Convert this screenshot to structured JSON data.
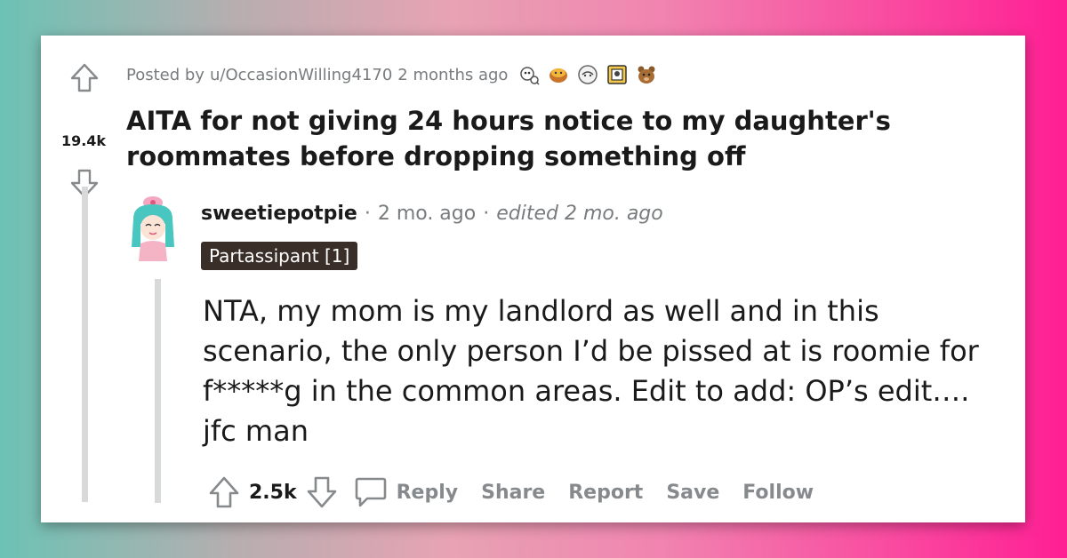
{
  "post": {
    "posted_by_prefix": "Posted by",
    "author": "u/OccasionWilling4170",
    "age": "2 months ago",
    "score": "19.4k",
    "title": "AITA for not giving 24 hours notice to my daughter's roommates before dropping something off"
  },
  "comment": {
    "author": "sweetiepotpie",
    "separator": "·",
    "age": "2 mo. ago",
    "edited": "edited 2 mo. ago",
    "flair": "Partassipant [1]",
    "body": "NTA, my mom is my landlord as well and in this scenario, the only person I’d be pissed at is roomie for f*****g in the common areas. Edit to add: OP’s edit…. jfc man",
    "score": "2.5k",
    "actions": {
      "reply": "Reply",
      "share": "Share",
      "report": "Report",
      "save": "Save",
      "follow": "Follow"
    }
  },
  "icons": [
    "upvote-icon",
    "downvote-icon",
    "comment-bubble-icon",
    "award-icon"
  ],
  "colors": {
    "text": "#1a1a1b",
    "muted": "#787c7e",
    "flair_bg": "#3a2f28",
    "thread_line": "#d7d9da"
  }
}
